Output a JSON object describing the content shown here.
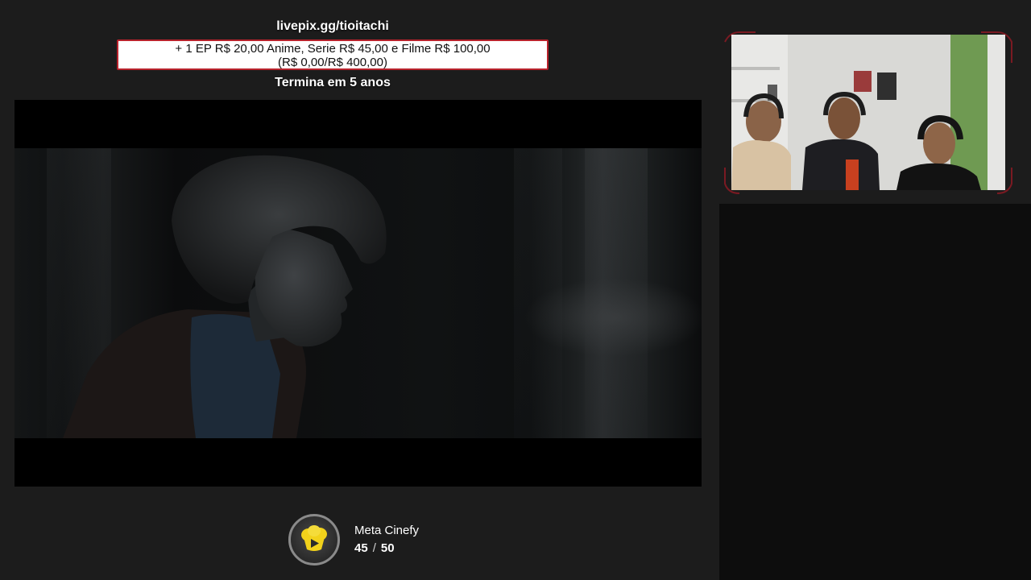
{
  "goal": {
    "url": "livepix.gg/tioitachi",
    "description_line1": "+ 1 EP R$ 20,00 Anime, Serie R$ 45,00 e Filme R$ 100,00",
    "description_line2": "(R$ 0,00/R$ 400,00)",
    "ends_in": "Termina em 5 anos"
  },
  "meta": {
    "title": "Meta Cinefy",
    "current": "45",
    "separator": "/",
    "total": "50",
    "icon": "popcorn-play-icon",
    "progress_fraction": 0.9
  },
  "colors": {
    "background": "#1c1c1c",
    "goal_border": "#b8222c",
    "accent_yellow": "#f2d21b",
    "chat_background": "#0d0d0d"
  }
}
